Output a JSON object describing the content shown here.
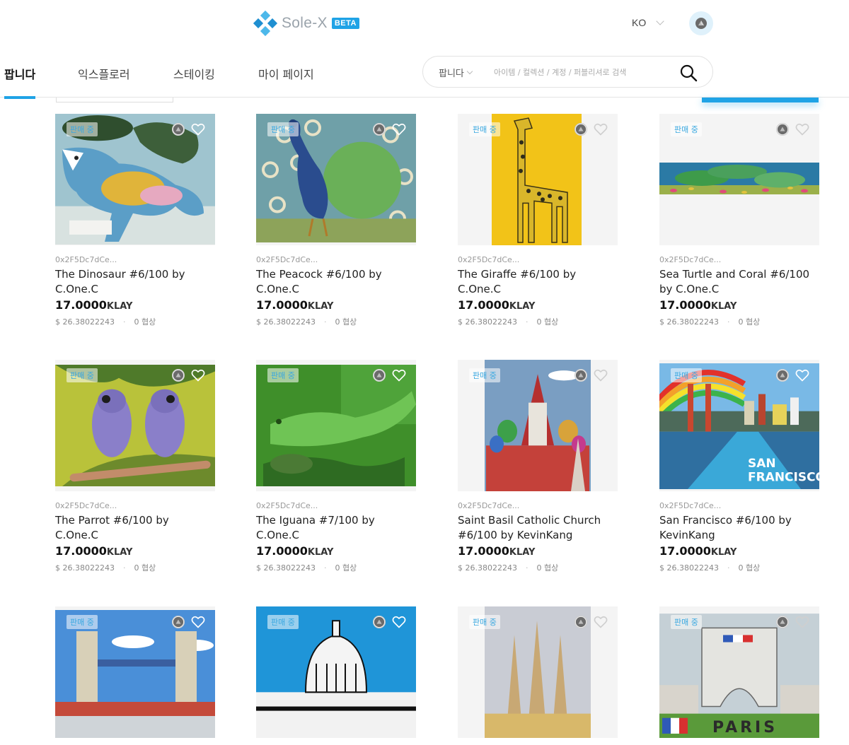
{
  "header": {
    "logo_text": "Sole-X",
    "beta": "BETA",
    "lang": "KO"
  },
  "nav": {
    "items": [
      "팝니다",
      "익스플로러",
      "스테이킹",
      "마이 페이지"
    ],
    "active": 0
  },
  "search": {
    "scope": "팝니다",
    "placeholder": "아이템 / 컬렉션 / 계정 / 퍼블리셔로 검색"
  },
  "colors": {
    "accent": "#1fa3e6",
    "badge_text": "#3aa8e0"
  },
  "cards": [
    {
      "badge": "판매 중",
      "owner": "0x2F5Dc7dCe...",
      "title": "The Dinosaur #6/100 by C.One.C",
      "price": "17.0000",
      "unit": "KLAY",
      "usd": "$ 26.38022243",
      "offers": "0 협상",
      "art": "dinosaur"
    },
    {
      "badge": "판매 중",
      "owner": "0x2F5Dc7dCe...",
      "title": "The Peacock #6/100 by C.One.C",
      "price": "17.0000",
      "unit": "KLAY",
      "usd": "$ 26.38022243",
      "offers": "0 협상",
      "art": "peacock"
    },
    {
      "badge": "판매 중",
      "owner": "0x2F5Dc7dCe...",
      "title": "The Giraffe #6/100 by C.One.C",
      "price": "17.0000",
      "unit": "KLAY",
      "usd": "$ 26.38022243",
      "offers": "0 협상",
      "art": "giraffe"
    },
    {
      "badge": "판매 중",
      "owner": "0x2F5Dc7dCe...",
      "title": "Sea Turtle and Coral #6/100 by C.One.C",
      "price": "17.0000",
      "unit": "KLAY",
      "usd": "$ 26.38022243",
      "offers": "0 협상",
      "art": "turtle"
    },
    {
      "badge": "판매 중",
      "owner": "0x2F5Dc7dCe...",
      "title": "The Parrot #6/100 by C.One.C",
      "price": "17.0000",
      "unit": "KLAY",
      "usd": "$ 26.38022243",
      "offers": "0 협상",
      "art": "parrot"
    },
    {
      "badge": "판매 중",
      "owner": "0x2F5Dc7dCe...",
      "title": "The Iguana #7/100 by C.One.C",
      "price": "17.0000",
      "unit": "KLAY",
      "usd": "$ 26.38022243",
      "offers": "0 협상",
      "art": "iguana"
    },
    {
      "badge": "판매 중",
      "owner": "0x2F5Dc7dCe...",
      "title": "Saint Basil Catholic Church #6/100 by KevinKang",
      "price": "17.0000",
      "unit": "KLAY",
      "usd": "$ 26.38022243",
      "offers": "0 협상",
      "art": "church"
    },
    {
      "badge": "판매 중",
      "owner": "0x2F5Dc7dCe...",
      "title": "San Francisco #6/100 by KevinKang",
      "price": "17.0000",
      "unit": "KLAY",
      "usd": "$ 26.38022243",
      "offers": "0 협상",
      "art": "sf",
      "art_text": [
        "SAN",
        "FRANCISCO"
      ]
    },
    {
      "badge": "판매 중",
      "owner": "",
      "title": "",
      "price": "",
      "unit": "",
      "usd": "",
      "offers": "",
      "art": "london"
    },
    {
      "badge": "판매 중",
      "owner": "",
      "title": "",
      "price": "",
      "unit": "",
      "usd": "",
      "offers": "",
      "art": "capitol"
    },
    {
      "badge": "판매 중",
      "owner": "",
      "title": "",
      "price": "",
      "unit": "",
      "usd": "",
      "offers": "",
      "art": "cathedral"
    },
    {
      "badge": "판매 중",
      "owner": "",
      "title": "",
      "price": "",
      "unit": "",
      "usd": "",
      "offers": "",
      "art": "paris",
      "art_text": [
        "PARIS"
      ]
    }
  ]
}
